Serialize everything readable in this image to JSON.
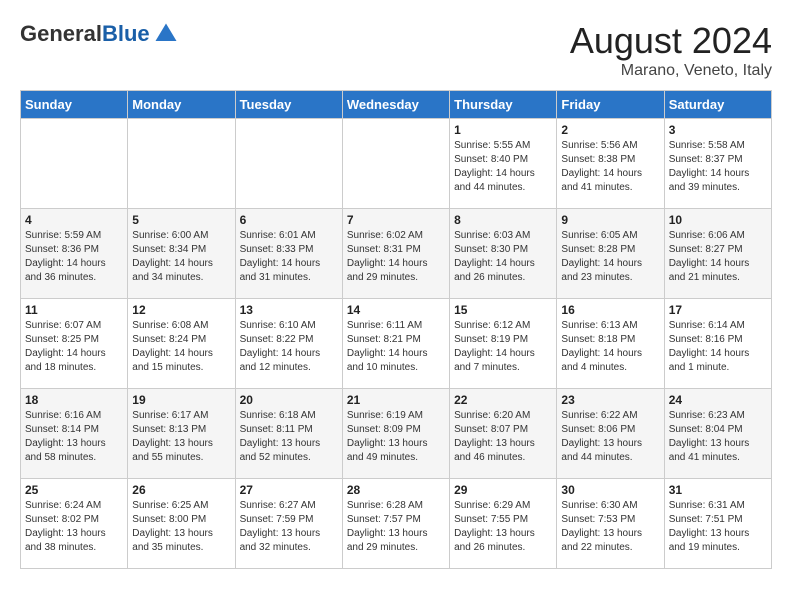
{
  "logo": {
    "general": "General",
    "blue": "Blue"
  },
  "header": {
    "month_year": "August 2024",
    "location": "Marano, Veneto, Italy"
  },
  "weekdays": [
    "Sunday",
    "Monday",
    "Tuesday",
    "Wednesday",
    "Thursday",
    "Friday",
    "Saturday"
  ],
  "weeks": [
    [
      {
        "day": "",
        "info": ""
      },
      {
        "day": "",
        "info": ""
      },
      {
        "day": "",
        "info": ""
      },
      {
        "day": "",
        "info": ""
      },
      {
        "day": "1",
        "info": "Sunrise: 5:55 AM\nSunset: 8:40 PM\nDaylight: 14 hours\nand 44 minutes."
      },
      {
        "day": "2",
        "info": "Sunrise: 5:56 AM\nSunset: 8:38 PM\nDaylight: 14 hours\nand 41 minutes."
      },
      {
        "day": "3",
        "info": "Sunrise: 5:58 AM\nSunset: 8:37 PM\nDaylight: 14 hours\nand 39 minutes."
      }
    ],
    [
      {
        "day": "4",
        "info": "Sunrise: 5:59 AM\nSunset: 8:36 PM\nDaylight: 14 hours\nand 36 minutes."
      },
      {
        "day": "5",
        "info": "Sunrise: 6:00 AM\nSunset: 8:34 PM\nDaylight: 14 hours\nand 34 minutes."
      },
      {
        "day": "6",
        "info": "Sunrise: 6:01 AM\nSunset: 8:33 PM\nDaylight: 14 hours\nand 31 minutes."
      },
      {
        "day": "7",
        "info": "Sunrise: 6:02 AM\nSunset: 8:31 PM\nDaylight: 14 hours\nand 29 minutes."
      },
      {
        "day": "8",
        "info": "Sunrise: 6:03 AM\nSunset: 8:30 PM\nDaylight: 14 hours\nand 26 minutes."
      },
      {
        "day": "9",
        "info": "Sunrise: 6:05 AM\nSunset: 8:28 PM\nDaylight: 14 hours\nand 23 minutes."
      },
      {
        "day": "10",
        "info": "Sunrise: 6:06 AM\nSunset: 8:27 PM\nDaylight: 14 hours\nand 21 minutes."
      }
    ],
    [
      {
        "day": "11",
        "info": "Sunrise: 6:07 AM\nSunset: 8:25 PM\nDaylight: 14 hours\nand 18 minutes."
      },
      {
        "day": "12",
        "info": "Sunrise: 6:08 AM\nSunset: 8:24 PM\nDaylight: 14 hours\nand 15 minutes."
      },
      {
        "day": "13",
        "info": "Sunrise: 6:10 AM\nSunset: 8:22 PM\nDaylight: 14 hours\nand 12 minutes."
      },
      {
        "day": "14",
        "info": "Sunrise: 6:11 AM\nSunset: 8:21 PM\nDaylight: 14 hours\nand 10 minutes."
      },
      {
        "day": "15",
        "info": "Sunrise: 6:12 AM\nSunset: 8:19 PM\nDaylight: 14 hours\nand 7 minutes."
      },
      {
        "day": "16",
        "info": "Sunrise: 6:13 AM\nSunset: 8:18 PM\nDaylight: 14 hours\nand 4 minutes."
      },
      {
        "day": "17",
        "info": "Sunrise: 6:14 AM\nSunset: 8:16 PM\nDaylight: 14 hours\nand 1 minute."
      }
    ],
    [
      {
        "day": "18",
        "info": "Sunrise: 6:16 AM\nSunset: 8:14 PM\nDaylight: 13 hours\nand 58 minutes."
      },
      {
        "day": "19",
        "info": "Sunrise: 6:17 AM\nSunset: 8:13 PM\nDaylight: 13 hours\nand 55 minutes."
      },
      {
        "day": "20",
        "info": "Sunrise: 6:18 AM\nSunset: 8:11 PM\nDaylight: 13 hours\nand 52 minutes."
      },
      {
        "day": "21",
        "info": "Sunrise: 6:19 AM\nSunset: 8:09 PM\nDaylight: 13 hours\nand 49 minutes."
      },
      {
        "day": "22",
        "info": "Sunrise: 6:20 AM\nSunset: 8:07 PM\nDaylight: 13 hours\nand 46 minutes."
      },
      {
        "day": "23",
        "info": "Sunrise: 6:22 AM\nSunset: 8:06 PM\nDaylight: 13 hours\nand 44 minutes."
      },
      {
        "day": "24",
        "info": "Sunrise: 6:23 AM\nSunset: 8:04 PM\nDaylight: 13 hours\nand 41 minutes."
      }
    ],
    [
      {
        "day": "25",
        "info": "Sunrise: 6:24 AM\nSunset: 8:02 PM\nDaylight: 13 hours\nand 38 minutes."
      },
      {
        "day": "26",
        "info": "Sunrise: 6:25 AM\nSunset: 8:00 PM\nDaylight: 13 hours\nand 35 minutes."
      },
      {
        "day": "27",
        "info": "Sunrise: 6:27 AM\nSunset: 7:59 PM\nDaylight: 13 hours\nand 32 minutes."
      },
      {
        "day": "28",
        "info": "Sunrise: 6:28 AM\nSunset: 7:57 PM\nDaylight: 13 hours\nand 29 minutes."
      },
      {
        "day": "29",
        "info": "Sunrise: 6:29 AM\nSunset: 7:55 PM\nDaylight: 13 hours\nand 26 minutes."
      },
      {
        "day": "30",
        "info": "Sunrise: 6:30 AM\nSunset: 7:53 PM\nDaylight: 13 hours\nand 22 minutes."
      },
      {
        "day": "31",
        "info": "Sunrise: 6:31 AM\nSunset: 7:51 PM\nDaylight: 13 hours\nand 19 minutes."
      }
    ]
  ]
}
